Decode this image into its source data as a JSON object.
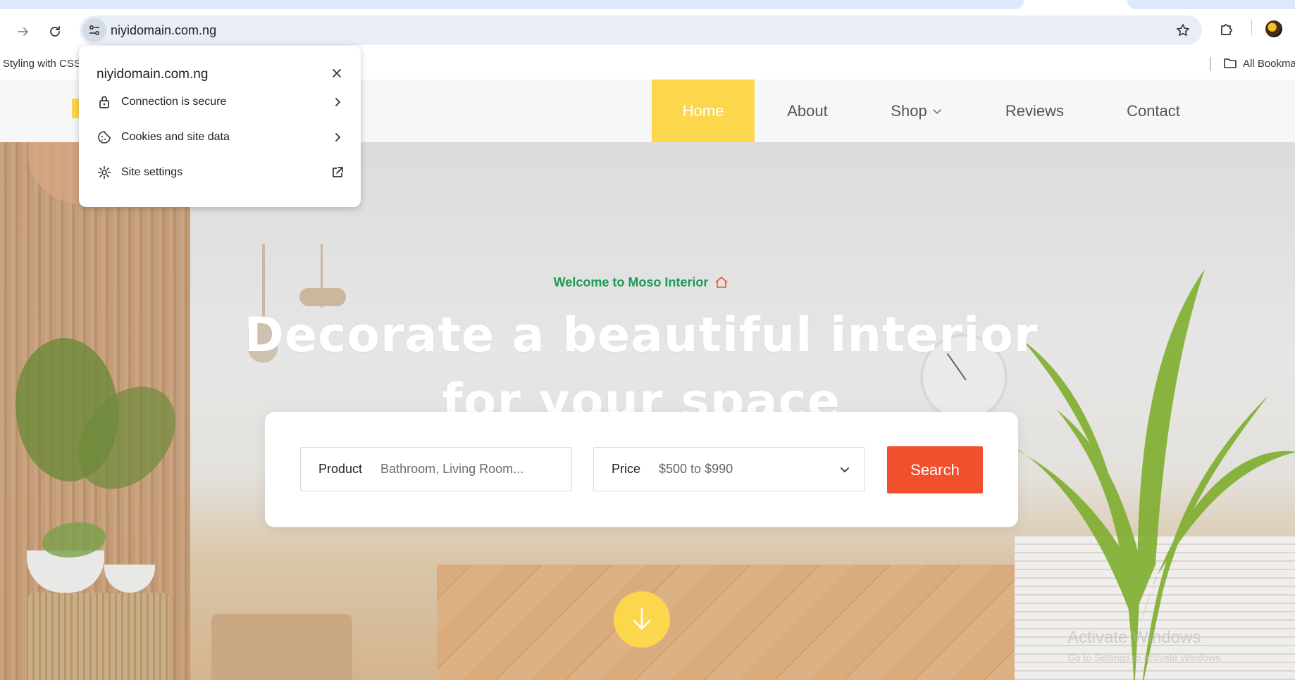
{
  "browser": {
    "url": "niyidomain.com.ng",
    "bookmarks": {
      "item_label": "Styling with CSS",
      "all_bookmarks_label": "All Bookma"
    }
  },
  "site_info_popup": {
    "title": "niyidomain.com.ng",
    "rows": [
      {
        "label": "Connection is secure",
        "icon": "lock-icon",
        "trailing": "chevron-right-icon"
      },
      {
        "label": "Cookies and site data",
        "icon": "cookie-icon",
        "trailing": "chevron-right-icon"
      },
      {
        "label": "Site settings",
        "icon": "gear-icon",
        "trailing": "external-link-icon"
      }
    ]
  },
  "site": {
    "nav": {
      "home": "Home",
      "about": "About",
      "shop": "Shop",
      "reviews": "Reviews",
      "contact": "Contact"
    },
    "hero": {
      "welcome": "Welcome to Moso Interior",
      "title_line1": "Decorate a beautiful interior",
      "title_line2": "for your space"
    },
    "search": {
      "product_label": "Product",
      "product_placeholder": "Bathroom, Living Room...",
      "price_label": "Price",
      "price_value": "$500 to $990",
      "button_label": "Search"
    },
    "watermark": {
      "line1": "Activate Windows",
      "line2": "Go to Settings to activate Windows."
    }
  },
  "colors": {
    "accent_yellow": "#fcd64c",
    "search_orange": "#f2502d",
    "welcome_green": "#1e9a55",
    "house_icon_red": "#f2502d"
  }
}
